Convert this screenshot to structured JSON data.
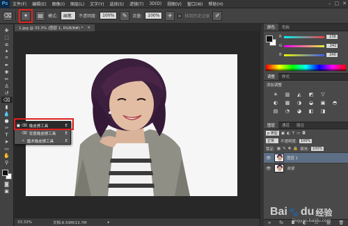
{
  "app": {
    "logo": "Ps",
    "menu": [
      "文件(F)",
      "编辑(E)",
      "图像(I)",
      "图层(L)",
      "文字(Y)",
      "选择(S)",
      "滤镜(T)",
      "3D(D)",
      "视图(V)",
      "窗口(W)",
      "帮助(H)"
    ],
    "window_controls": [
      "–",
      "□",
      "✕"
    ]
  },
  "options_bar": {
    "tool_icon": "eraser-icon",
    "mode_label": "模式:",
    "mode_value": "画笔",
    "opacity_label": "不透明度:",
    "opacity_value": "100%",
    "flow_label": "流量:",
    "flow_value": "100%",
    "history_label": "抹到历史记录"
  },
  "document": {
    "tab_title": "1.jpg @ 33.3% (图层 1, RGB/8#) *",
    "zoom": "33.33%",
    "doc_size": "文档:6.59M/13.7M"
  },
  "tool_flyout": {
    "items": [
      {
        "mark": "■",
        "label": "橡皮擦工具",
        "key": "E"
      },
      {
        "mark": "",
        "label": "背景橡皮擦工具",
        "key": "E"
      },
      {
        "mark": "",
        "label": "魔术橡皮擦工具",
        "key": "E"
      }
    ]
  },
  "color_panel": {
    "tabs": [
      "颜色",
      "色板"
    ],
    "rows": [
      {
        "label": "R",
        "value": "236",
        "color": "#f03d4a"
      },
      {
        "label": "G",
        "value": "242",
        "color": "#e8f03a"
      },
      {
        "label": "B",
        "value": "240",
        "color": "#3a5cf0"
      }
    ]
  },
  "adjustments_panel": {
    "tabs": [
      "调整",
      "样式"
    ],
    "title": "添加调整",
    "icons": [
      "☀",
      "▥",
      "◭",
      "◩",
      "▽",
      "◐",
      "▦",
      "◑",
      "◒",
      "▣",
      "◓",
      "▤",
      "◔",
      "◕",
      "◧",
      "◨"
    ]
  },
  "layers_panel": {
    "tabs": [
      "图层",
      "通道",
      "路径"
    ],
    "filter_label": "ρ 类型",
    "blend_mode": "正常",
    "opacity_label": "不透明度:",
    "opacity_value": "100%",
    "lock_label": "锁定:",
    "fill_label": "填充:",
    "fill_value": "100%",
    "layers": [
      {
        "name": "图层 1",
        "selected": true
      },
      {
        "name": "背景",
        "selected": false
      }
    ],
    "bottom_icons": [
      "∞",
      "fx",
      "◘",
      "◐",
      "▭",
      "▤",
      "🗑"
    ]
  },
  "watermark": {
    "brand": "Bai",
    "brand_mid": "du",
    "brand_tail": "经验",
    "sub": "jingyan.baidu.com"
  }
}
